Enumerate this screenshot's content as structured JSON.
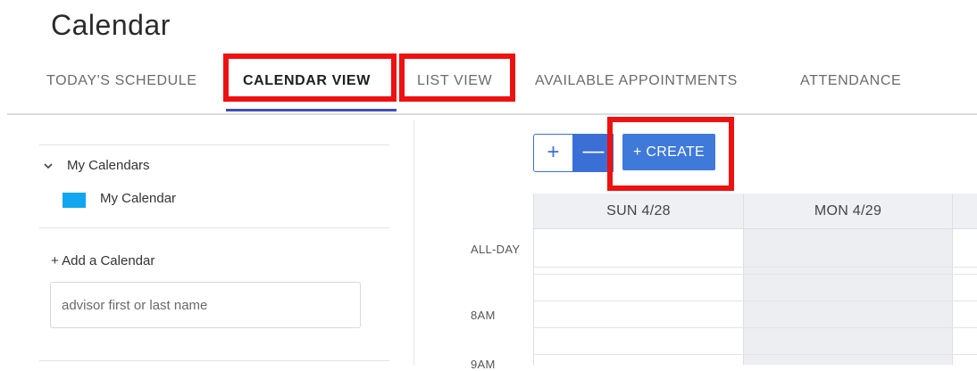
{
  "page": {
    "title": "Calendar"
  },
  "tabs": [
    {
      "label": "TODAY'S SCHEDULE"
    },
    {
      "label": "CALENDAR VIEW"
    },
    {
      "label": "LIST VIEW"
    },
    {
      "label": "AVAILABLE APPOINTMENTS"
    },
    {
      "label": "ATTENDANCE"
    }
  ],
  "active_tab": "CALENDAR VIEW",
  "sidebar": {
    "section_label": "My Calendars",
    "calendar_name": "My Calendar",
    "calendar_color": "#11a6ef",
    "add_label": "+ Add a Calendar",
    "search_placeholder": "advisor first or last name"
  },
  "toolbar": {
    "zoom_in_label": "+",
    "zoom_out_label": "—",
    "create_label": "+ CREATE"
  },
  "calendar": {
    "columns": [
      {
        "label": "SUN 4/28"
      },
      {
        "label": "MON 4/29"
      }
    ],
    "allday_label": "ALL-DAY",
    "times": [
      "8AM",
      "9AM"
    ]
  },
  "colors": {
    "accent": "#3f79d9",
    "tab_underline": "#3f4fb5",
    "highlight": "#ee1111"
  }
}
